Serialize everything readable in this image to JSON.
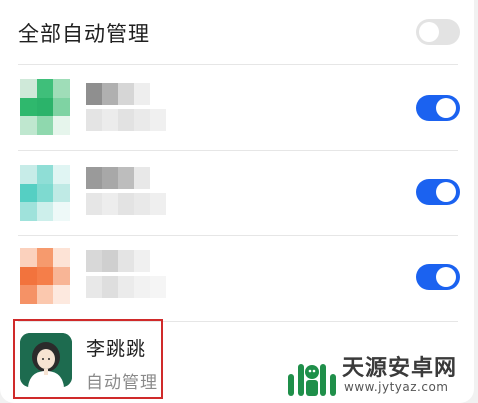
{
  "header": {
    "title": "全部自动管理",
    "toggle_on": false
  },
  "apps": [
    {
      "name": "",
      "sub": "",
      "toggle_on": true,
      "icon_colors": [
        "#cfe9d9",
        "#3fbf7a",
        "#9fddb8",
        "#2fb86d",
        "#2bb36a",
        "#7fd3a3",
        "#bfe7cf",
        "#8fd8ae",
        "#e6f5ec"
      ]
    },
    {
      "name": "",
      "sub": "",
      "toggle_on": true,
      "icon_colors": [
        "#c7ece8",
        "#8fded6",
        "#e0f5f3",
        "#55cfc3",
        "#7edad0",
        "#bfeae5",
        "#9fe2db",
        "#cdefeb",
        "#eef9f8"
      ]
    },
    {
      "name": "",
      "sub": "",
      "toggle_on": true,
      "icon_colors": [
        "#fbd1bd",
        "#f69a6d",
        "#fde3d6",
        "#f2733d",
        "#f57e49",
        "#f8b596",
        "#f59266",
        "#fbc8ae",
        "#fde9df"
      ]
    }
  ],
  "selected_app": {
    "name": "李跳跳",
    "sub": "自动管理"
  },
  "watermark": {
    "text": "天源安卓网",
    "url": "www.jytyaz.com"
  }
}
